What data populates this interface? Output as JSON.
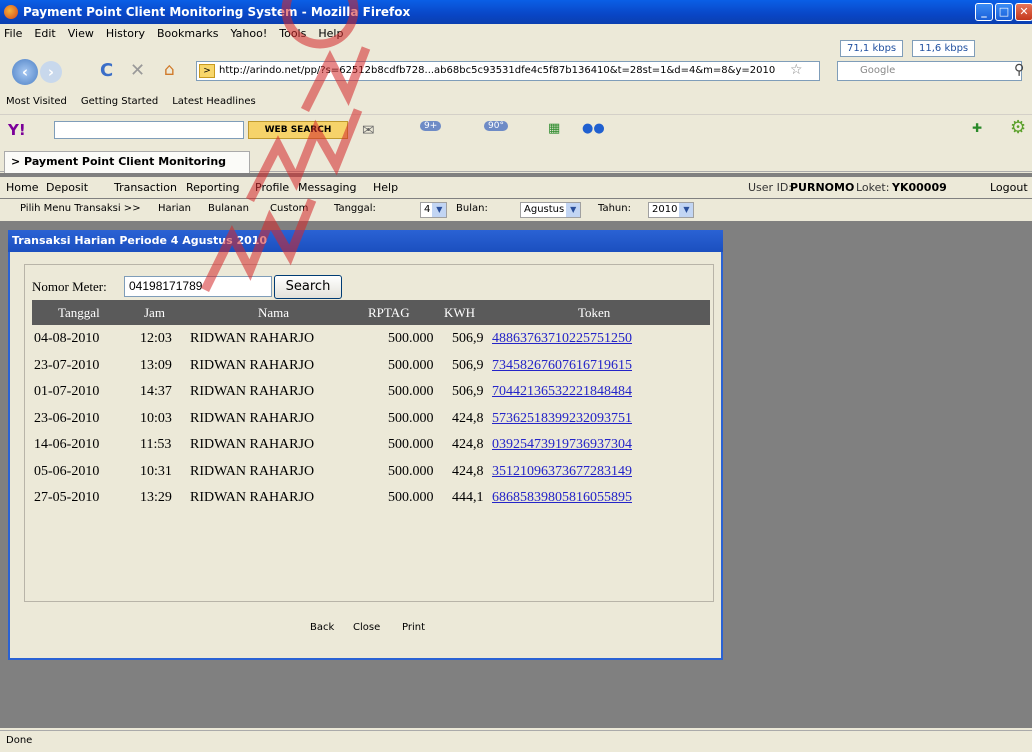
{
  "window": {
    "title": "Payment Point Client Monitoring System - Mozilla Firefox"
  },
  "menu": [
    "File",
    "Edit",
    "View",
    "History",
    "Bookmarks",
    "Yahoo!",
    "Tools",
    "Help"
  ],
  "speeds": {
    "down": "71,1 kbps",
    "up": "11,6 kbps"
  },
  "nav": {
    "url": "http://arindo.net/pp/?s=62512b8cdfb728...ab68bc5c93531dfe4c5f87b136410&t=28st=1&d=4&m=8&y=2010",
    "search_placeholder": "Google"
  },
  "bookmarks": [
    "Most Visited",
    "Getting Started",
    "Latest Headlines"
  ],
  "yahoo": {
    "search_button": "WEB SEARCH",
    "mail_count": "9+",
    "weather": "90°"
  },
  "tab": {
    "label": "Payment Point Client Monitoring Sys..."
  },
  "app_menu": {
    "items": [
      "Home",
      "Deposit",
      "Transaction",
      "Reporting",
      "Profile",
      "Messaging",
      "Help"
    ],
    "user_label": "User ID:",
    "user_id": "PURNOMO",
    "loket_label": "Loket:",
    "loket_id": "YK00009",
    "logout": "Logout"
  },
  "submenu": {
    "prefix": "Pilih Menu Transaksi >>",
    "items": [
      "Harian",
      "Bulanan",
      "Custom"
    ],
    "tanggal_label": "Tanggal:",
    "tanggal_value": "4",
    "bulan_label": "Bulan:",
    "bulan_value": "Agustus",
    "tahun_label": "Tahun:",
    "tahun_value": "2010"
  },
  "dialog": {
    "title": "Transaksi Harian Periode 4 Agustus 2010",
    "meter_label": "Nomor Meter:",
    "meter_value": "04198171789",
    "search_label": "Search",
    "columns": [
      "Tanggal",
      "Jam",
      "Nama",
      "RPTAG",
      "KWH",
      "Token"
    ],
    "rows": [
      {
        "tanggal": "04-08-2010",
        "jam": "12:03",
        "nama": "RIDWAN RAHARJO",
        "rptag": "500.000",
        "kwh": "506,9",
        "token": "48863763710225751250"
      },
      {
        "tanggal": "23-07-2010",
        "jam": "13:09",
        "nama": "RIDWAN RAHARJO",
        "rptag": "500.000",
        "kwh": "506,9",
        "token": "73458267607616719615"
      },
      {
        "tanggal": "01-07-2010",
        "jam": "14:37",
        "nama": "RIDWAN RAHARJO",
        "rptag": "500.000",
        "kwh": "506,9",
        "token": "70442136532221848484"
      },
      {
        "tanggal": "23-06-2010",
        "jam": "10:03",
        "nama": "RIDWAN RAHARJO",
        "rptag": "500.000",
        "kwh": "424,8",
        "token": "57362518399232093751"
      },
      {
        "tanggal": "14-06-2010",
        "jam": "11:53",
        "nama": "RIDWAN RAHARJO",
        "rptag": "500.000",
        "kwh": "424,8",
        "token": "03925473919736937304"
      },
      {
        "tanggal": "05-06-2010",
        "jam": "10:31",
        "nama": "RIDWAN RAHARJO",
        "rptag": "500.000",
        "kwh": "424,8",
        "token": "35121096373677283149"
      },
      {
        "tanggal": "27-05-2010",
        "jam": "13:29",
        "nama": "RIDWAN RAHARJO",
        "rptag": "500.000",
        "kwh": "444,1",
        "token": "68685839805816055895"
      }
    ],
    "footer": [
      "Back",
      "Close",
      "Print"
    ]
  },
  "status": "Done"
}
